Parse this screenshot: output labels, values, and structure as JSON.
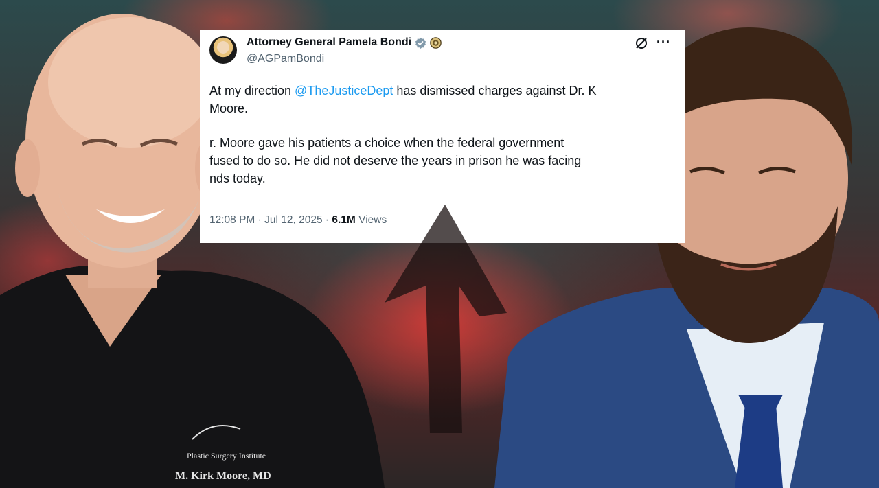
{
  "tweet": {
    "display_name": "Attorney General Pamela Bondi",
    "handle": "@AGPamBondi",
    "paragraph1_prefix": "At my direction ",
    "mention": "@TheJusticeDept",
    "paragraph1_suffix": " has dismissed charges against Dr. K\nMoore.",
    "paragraph2": "r. Moore gave his patients a choice when the federal government\nfused to do so. He did not deserve the years in prison he was facing\nnds today.",
    "time_date": "12:08 PM · Jul 12, 2025 · ",
    "views_count": "6.1M",
    "views_label": " Views"
  },
  "icons": {
    "verified": "verified-check-icon",
    "government_badge": "government-seal-icon",
    "grok": "grok-icon",
    "more": "more-options-icon",
    "arrow": "up-arrow-icon"
  },
  "colors": {
    "accent": "#1d9bf0",
    "text": "#0f1419",
    "muted": "#536471",
    "background_red": "#c23a35"
  },
  "scrub_text": "M. Kirk Moore, MD"
}
